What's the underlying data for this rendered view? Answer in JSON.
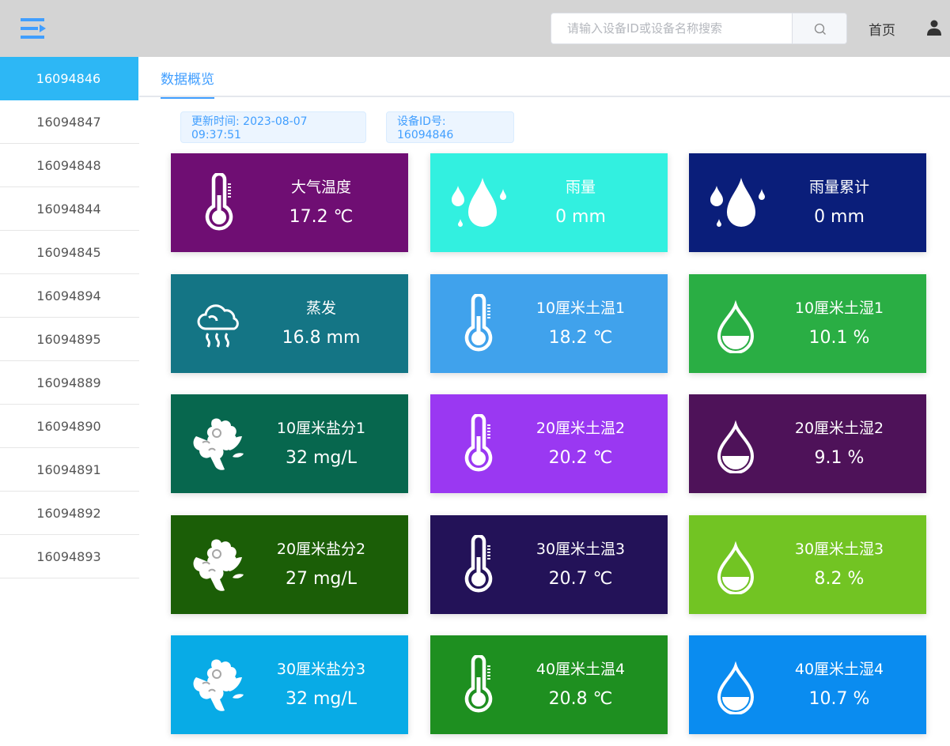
{
  "header": {
    "search_placeholder": "请输入设备ID或设备名称搜索",
    "home_label": "首页"
  },
  "sidebar": {
    "items": [
      {
        "label": "16094846",
        "active": true
      },
      {
        "label": "16094847"
      },
      {
        "label": "16094848"
      },
      {
        "label": "16094844"
      },
      {
        "label": "16094845"
      },
      {
        "label": "16094894"
      },
      {
        "label": "16094895"
      },
      {
        "label": "16094889"
      },
      {
        "label": "16094890"
      },
      {
        "label": "16094891"
      },
      {
        "label": "16094892"
      },
      {
        "label": "16094893"
      }
    ]
  },
  "tabs": [
    {
      "label": "数据概览"
    }
  ],
  "info": {
    "update_time": "更新时间: 2023-08-07 09:37:51",
    "device_id": "设备ID号: 16094846"
  },
  "cards": [
    {
      "title": "大气温度",
      "value": "17.2 ℃",
      "icon": "thermometer-icon",
      "color": "#6f0e73"
    },
    {
      "title": "雨量",
      "value": "0 mm",
      "icon": "raindrops-icon",
      "color": "#32f0e0"
    },
    {
      "title": "雨量累计",
      "value": "0 mm",
      "icon": "raindrops-icon",
      "color": "#0a1e7a"
    },
    {
      "title": "蒸发",
      "value": "16.8 mm",
      "icon": "evaporation-icon",
      "color": "#147585"
    },
    {
      "title": "10厘米土温1",
      "value": "18.2 ℃",
      "icon": "thermometer-icon",
      "color": "#40a2ec"
    },
    {
      "title": "10厘米土湿1",
      "value": "10.1 %",
      "icon": "water-drop-icon",
      "color": "#2aae44"
    },
    {
      "title": "10厘米盐分1",
      "value": "32 mg/L",
      "icon": "flower-icon",
      "color": "#07674e"
    },
    {
      "title": "20厘米土温2",
      "value": "20.2 ℃",
      "icon": "thermometer-icon",
      "color": "#9a38f2"
    },
    {
      "title": "20厘米土湿2",
      "value": "9.1 %",
      "icon": "water-drop-icon",
      "color": "#4e1259"
    },
    {
      "title": "20厘米盐分2",
      "value": "27 mg/L",
      "icon": "flower-icon",
      "color": "#1b5e07"
    },
    {
      "title": "30厘米土温3",
      "value": "20.7 ℃",
      "icon": "thermometer-icon",
      "color": "#231258"
    },
    {
      "title": "30厘米土湿3",
      "value": "8.2 %",
      "icon": "water-drop-icon",
      "color": "#72c423"
    },
    {
      "title": "30厘米盐分3",
      "value": "32 mg/L",
      "icon": "flower-icon",
      "color": "#08abe6"
    },
    {
      "title": "40厘米土温4",
      "value": "20.8 ℃",
      "icon": "thermometer-icon",
      "color": "#1e8f20"
    },
    {
      "title": "40厘米土湿4",
      "value": "10.7 %",
      "icon": "water-drop-icon",
      "color": "#0a8cf0"
    }
  ]
}
